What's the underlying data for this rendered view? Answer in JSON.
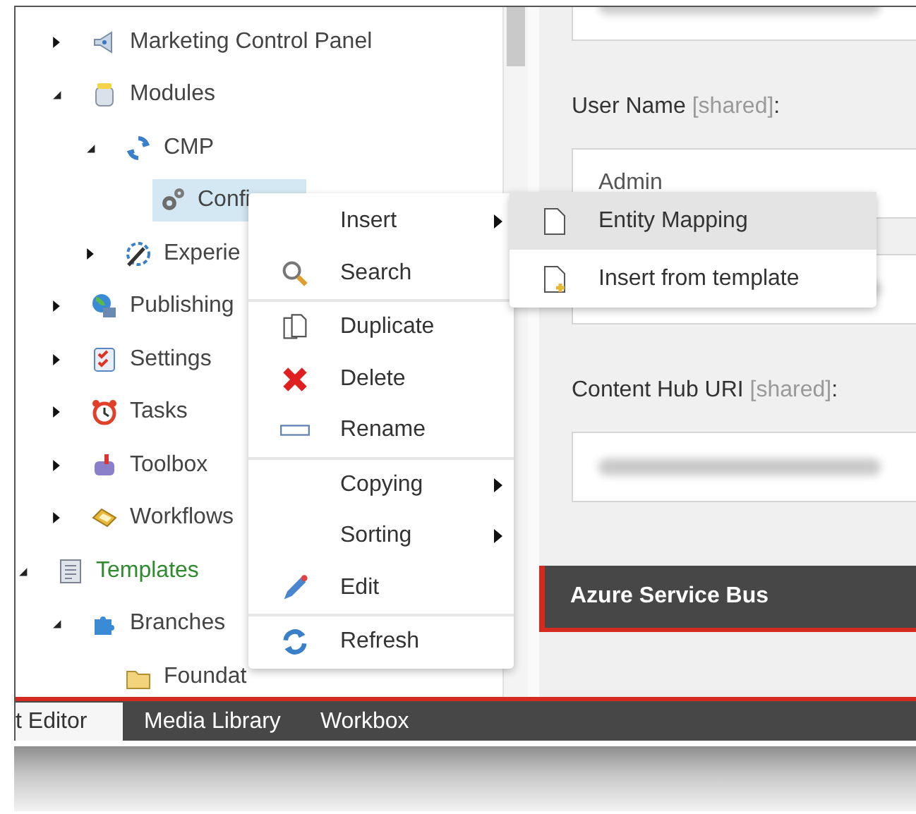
{
  "tree": {
    "continued_children": [
      {
        "label": "Marketing Control Panel",
        "expanded": false,
        "selected": false
      },
      {
        "label": "Modules",
        "expanded": true,
        "selected": false,
        "children": [
          {
            "label": "CMP",
            "expanded": true,
            "selected": false,
            "children": [
              {
                "label": "Confi",
                "selected": true
              }
            ]
          },
          {
            "label": "Experie",
            "expanded": false,
            "selected": false
          }
        ]
      },
      {
        "label": "Publishing",
        "expanded": false,
        "selected": false
      },
      {
        "label": "Settings",
        "expanded": false,
        "selected": false
      },
      {
        "label": "Tasks",
        "expanded": false,
        "selected": false
      },
      {
        "label": "Toolbox",
        "expanded": false,
        "selected": false
      },
      {
        "label": "Workflows",
        "expanded": false,
        "selected": false
      }
    ],
    "nodes": [
      {
        "label": "Templates",
        "expanded": true,
        "selected": false,
        "color": "#2e8b2e",
        "children": [
          {
            "label": "Branches",
            "expanded": true,
            "selected": false,
            "children": [
              {
                "label": "Foundat",
                "selected": false
              }
            ]
          }
        ]
      }
    ]
  },
  "form": {
    "fields": [
      {
        "kind": "blurred"
      },
      {
        "label": "User Name",
        "tag": "[shared]",
        "suffix": ":",
        "kind": "text",
        "value": "Admin"
      },
      {
        "kind": "blurred"
      },
      {
        "label": "Content Hub URI",
        "tag": "[shared]",
        "suffix": ":",
        "kind": "blurred"
      }
    ],
    "section": "Azure Service Bus"
  },
  "bottom_tabs": [
    {
      "label": "t Editor",
      "selected": true
    },
    {
      "label": "Media Library",
      "selected": false
    },
    {
      "label": "Workbox",
      "selected": false
    }
  ],
  "context_menu": {
    "sections": [
      [
        {
          "label": "Insert",
          "submenu": true
        },
        {
          "label": "Search",
          "submenu": false
        }
      ],
      [
        {
          "label": "Duplicate",
          "submenu": false
        },
        {
          "label": "Delete",
          "submenu": false
        },
        {
          "label": "Rename",
          "submenu": false
        }
      ],
      [
        {
          "label": "Copying",
          "submenu": true
        },
        {
          "label": "Sorting",
          "submenu": true
        },
        {
          "label": "Edit",
          "submenu": false
        }
      ],
      [
        {
          "label": "Refresh",
          "submenu": false
        }
      ]
    ]
  },
  "submenu": [
    {
      "label": "Entity Mapping",
      "selected": true
    },
    {
      "label": "Insert from template",
      "selected": false
    }
  ]
}
